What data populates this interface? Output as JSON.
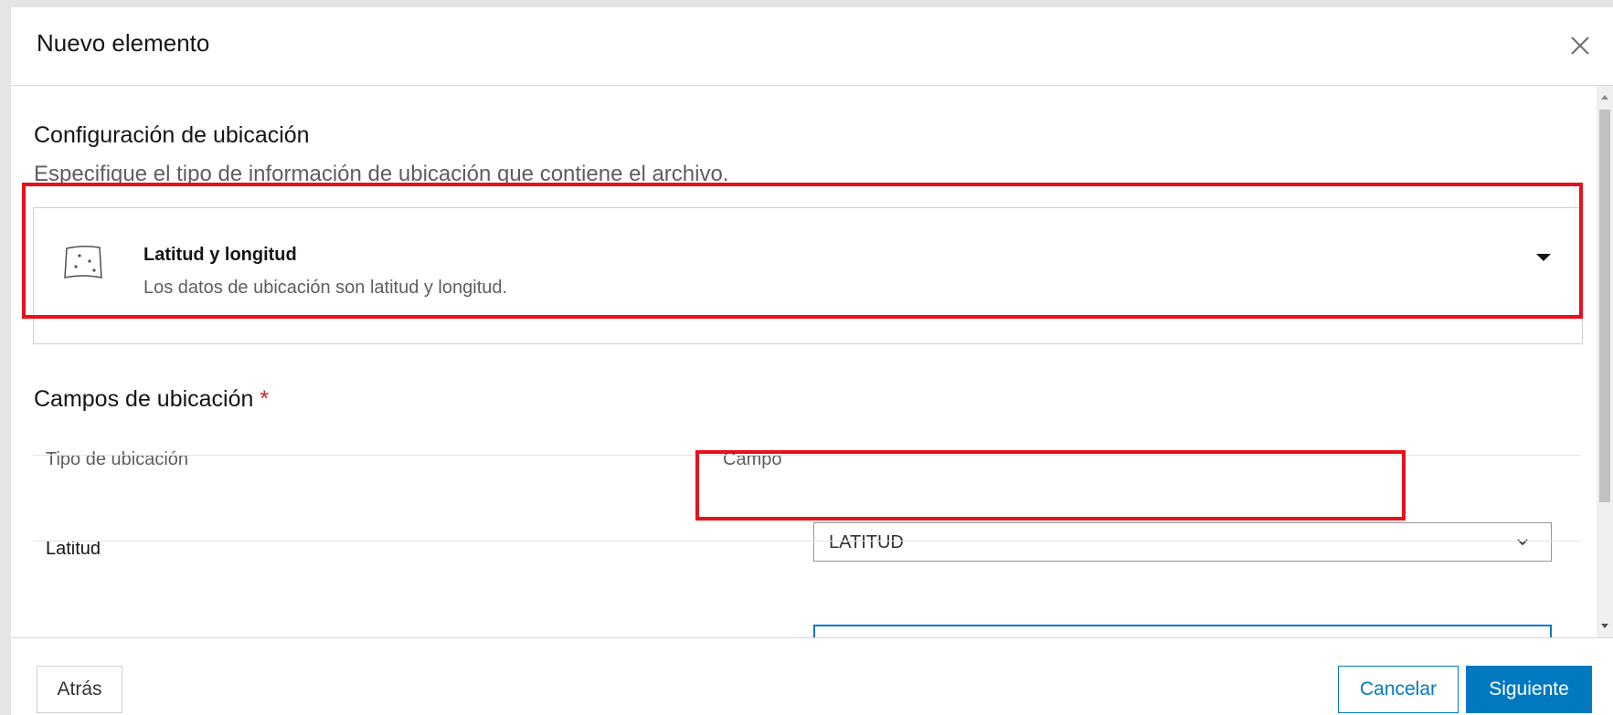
{
  "dialog": {
    "title": "Nuevo elemento",
    "close_icon": "close-icon"
  },
  "location_settings": {
    "title": "Configuración de ubicación",
    "description": "Especifique el tipo de información de ubicación que contiene el archivo.",
    "selected_type": {
      "icon": "map-points-icon",
      "label": "Latitud y longitud",
      "description": "Los datos de ubicación son latitud y longitud."
    }
  },
  "location_fields": {
    "title": "Campos de ubicación",
    "required_marker": "*",
    "columns": [
      "Tipo de ubicación",
      "Campo"
    ],
    "rows": [
      {
        "type": "Latitud",
        "field": "LATITUD"
      }
    ]
  },
  "footer": {
    "back_label": "Atrás",
    "cancel_label": "Cancelar",
    "next_label": "Siguiente"
  },
  "colors": {
    "primary": "#0079c1",
    "highlight": "#e8101a",
    "required": "#c62828"
  }
}
